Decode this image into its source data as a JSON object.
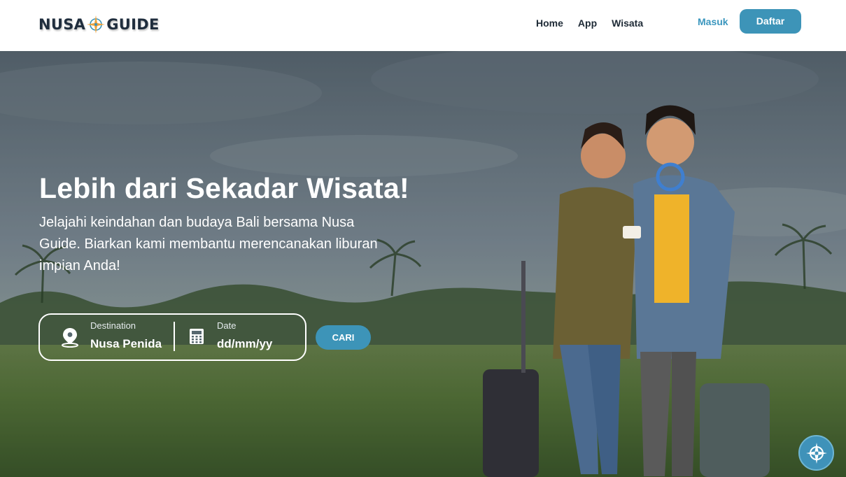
{
  "header": {
    "logo_left": "NUSA",
    "logo_right": "GUIDE",
    "nav": [
      "Home",
      "App",
      "Wisata"
    ],
    "login_label": "Masuk",
    "register_label": "Daftar"
  },
  "hero": {
    "headline": "Lebih dari Sekadar Wisata!",
    "subline": "Jelajahi keindahan dan budaya Bali bersama Nusa Guide. Biarkan kami membantu merencanakan liburan impian Anda!",
    "search": {
      "destination_label": "Destination",
      "destination_value": "Nusa Penida",
      "date_label": "Date",
      "date_value": "dd/mm/yy",
      "button_label": "CARI"
    }
  },
  "icons": {
    "logo": "compass-icon",
    "destination": "map-pin-icon",
    "date": "calendar-icon",
    "fab": "compass-icon"
  },
  "colors": {
    "accent": "#3d94b8",
    "login_text": "#3a96be",
    "nav_text": "#1e2a36"
  }
}
